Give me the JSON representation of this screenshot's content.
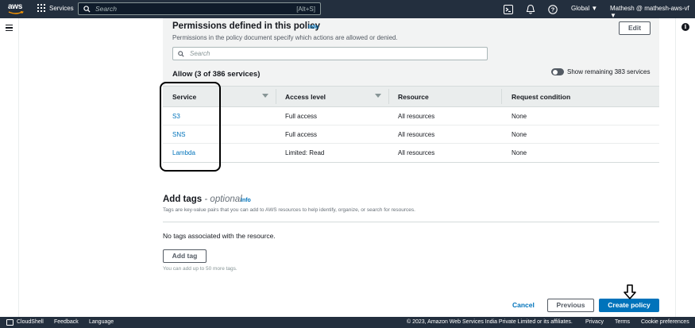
{
  "topnav": {
    "logo_text": "aws",
    "services_label": "Services",
    "search_placeholder": "Search",
    "search_shortcut": "[Alt+S]",
    "icons": [
      "cloudshell-icon",
      "bell-icon",
      "help-icon"
    ],
    "region_label": "Global ▼",
    "user_label": "Mathesh @ mathesh-aws-vf ▼"
  },
  "permissions": {
    "title": "Permissions defined in this policy",
    "info_label": "Info",
    "description": "Permissions in the policy document specify which actions are allowed or denied.",
    "edit_label": "Edit",
    "search_placeholder": "Search",
    "allow_title": "Allow (3 of 386 services)",
    "toggle_label": "Show remaining 383 services",
    "columns": [
      "Service",
      "Access level",
      "Resource",
      "Request condition"
    ],
    "rows": [
      {
        "service": "S3",
        "access": "Full access",
        "resource": "All resources",
        "condition": "None"
      },
      {
        "service": "SNS",
        "access": "Full access",
        "resource": "All resources",
        "condition": "None"
      },
      {
        "service": "Lambda",
        "access": "Limited: Read",
        "resource": "All resources",
        "condition": "None"
      }
    ]
  },
  "tags": {
    "title": "Add tags",
    "optional": "- optional",
    "info_label": "Info",
    "description": "Tags are key-value pairs that you can add to AWS resources to help identify, organize, or search for resources.",
    "empty_text": "No tags associated with the resource.",
    "add_tag_label": "Add tag",
    "hint": "You can add up to 50 more tags."
  },
  "actions": {
    "cancel_label": "Cancel",
    "previous_label": "Previous",
    "create_label": "Create policy"
  },
  "footer": {
    "cloudshell": "CloudShell",
    "feedback": "Feedback",
    "language": "Language",
    "copyright": "© 2023, Amazon Web Services India Private Limited or its affiliates.",
    "privacy": "Privacy",
    "terms": "Terms",
    "cookies": "Cookie preferences"
  },
  "colors": {
    "nav_bg": "#232f3e",
    "link": "#0073bb",
    "primary_button": "#0073bb",
    "panel_bg": "#f2f3f3"
  }
}
